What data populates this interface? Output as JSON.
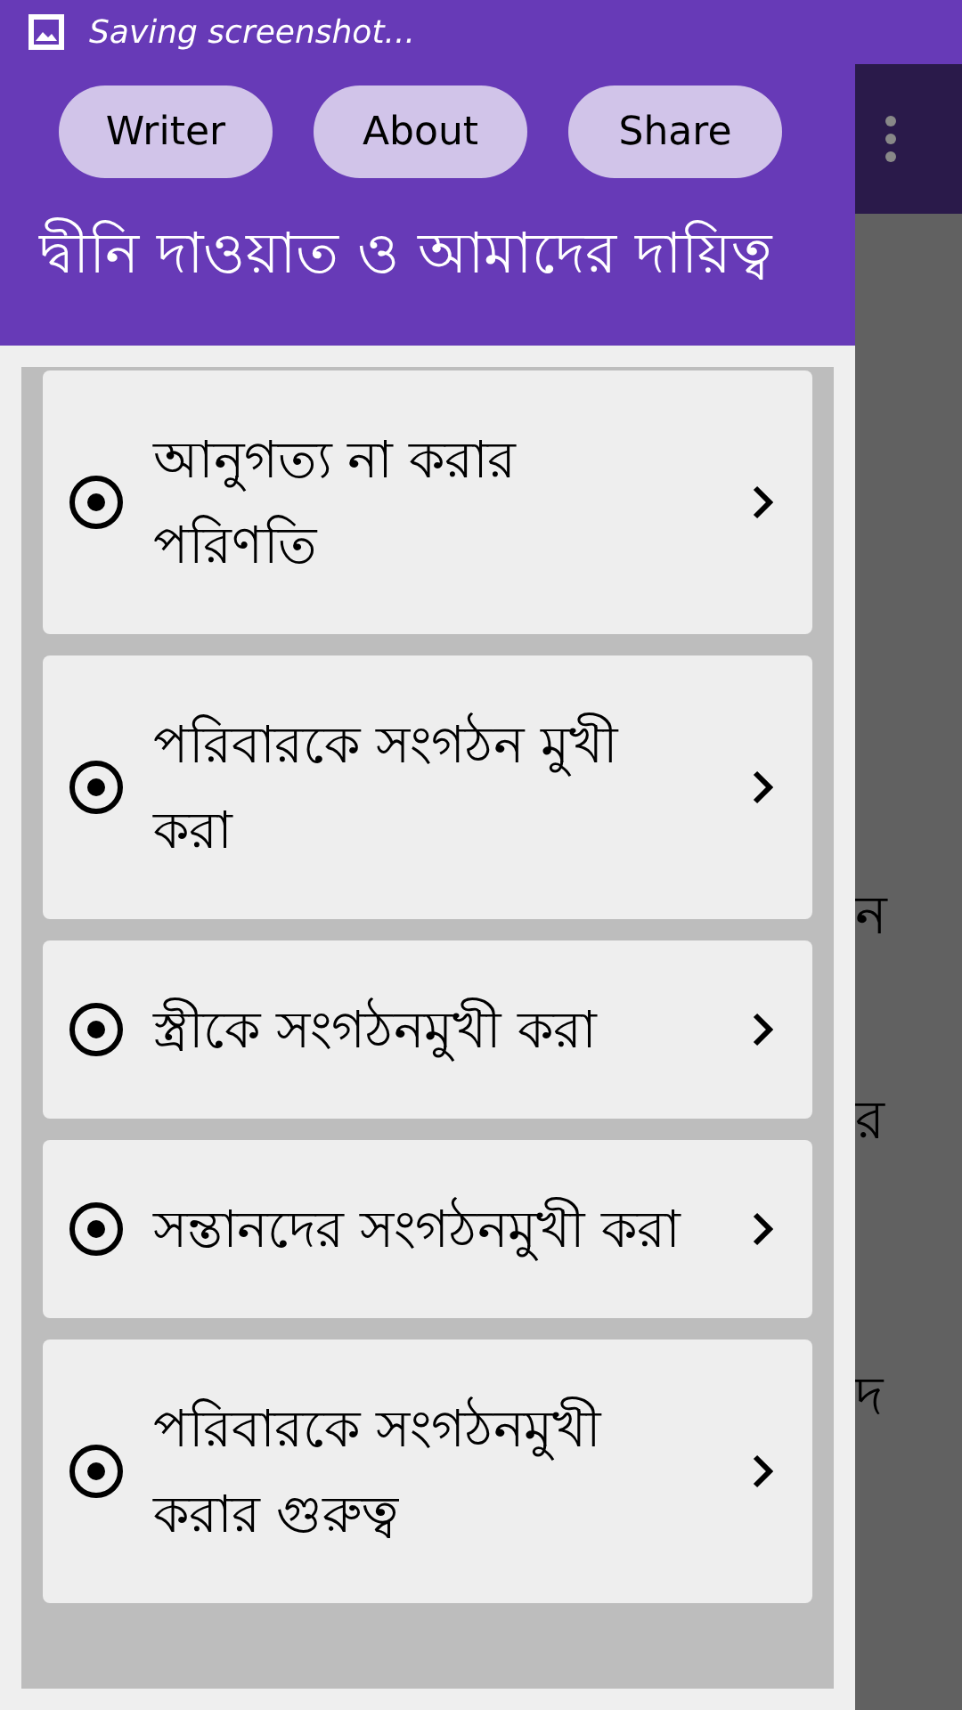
{
  "status_bar": {
    "notification": "Saving screenshot..."
  },
  "drawer": {
    "buttons": [
      "Writer",
      "About",
      "Share"
    ],
    "title": "দ্বীনি দাওয়াত ও আমাদের দায়িত্ব",
    "items": [
      {
        "label": "আনুগত্য না করার পরিণতি"
      },
      {
        "label": "পরিবারকে সংগঠন মুখী করা"
      },
      {
        "label": "স্ত্রীকে সংগঠনমুখী করা"
      },
      {
        "label": "সন্তানদের সংগঠনমুখী করা"
      },
      {
        "label": "পরিবারকে সংগঠনমুখী করার গুরুত্ব"
      }
    ]
  },
  "background": {
    "fragments": [
      "ন",
      "র",
      "দ"
    ]
  }
}
